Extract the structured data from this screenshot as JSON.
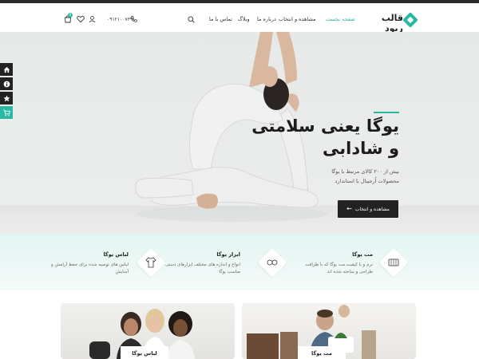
{
  "header": {
    "logo_text": "قالب ریود",
    "nav": [
      {
        "label": "صفحه نخست",
        "active": true
      },
      {
        "label": "مشاهده و انتخاب",
        "active": false
      },
      {
        "label": "درباره ما",
        "active": false
      },
      {
        "label": "وبلاگ",
        "active": false
      },
      {
        "label": "تماس با ما",
        "active": false
      }
    ],
    "phone": "۰۹۱۲۱۰۰۷۳۹۱",
    "cart_count": "0",
    "icons": [
      "search-icon",
      "phone-icon",
      "user-icon",
      "heart-icon",
      "cart-icon"
    ]
  },
  "hero": {
    "title_line1": "یوگا یعنی سلامتی",
    "title_line2": "و شادابی",
    "subtitle_line1": "بیش از ۲۰۰ کالای مرتبط با یوگا",
    "subtitle_line2": "محصولات اُرجینال با استاندارد",
    "button_label": "مشاهده و انتخاب"
  },
  "sidebar": {
    "icons": [
      "home-icon",
      "info-icon",
      "star-icon",
      "cart-icon"
    ]
  },
  "features": [
    {
      "title": "مت یوگا",
      "desc_line1": "نرم و با کیفیت مت یوگا که با ظرافت",
      "desc_line2": "طراحی و ساخته شده اند",
      "icon": "mat-icon"
    },
    {
      "title": "ابزار یوگا",
      "desc_line1": "انواع و اندازه های مختلف ابزارهای دستی",
      "desc_line2": "مناسب یوگا",
      "icon": "tools-icon"
    },
    {
      "title": "لباس یوگا",
      "desc_line1": "لباس های توصیه شده برای حفظ آرامش و",
      "desc_line2": "آسایش",
      "icon": "clothes-icon"
    }
  ],
  "categories": [
    {
      "label": "لباس یوگا"
    },
    {
      "label": "مت یوگا"
    }
  ],
  "colors": {
    "accent": "#2bb8a3",
    "dark": "#222222"
  }
}
